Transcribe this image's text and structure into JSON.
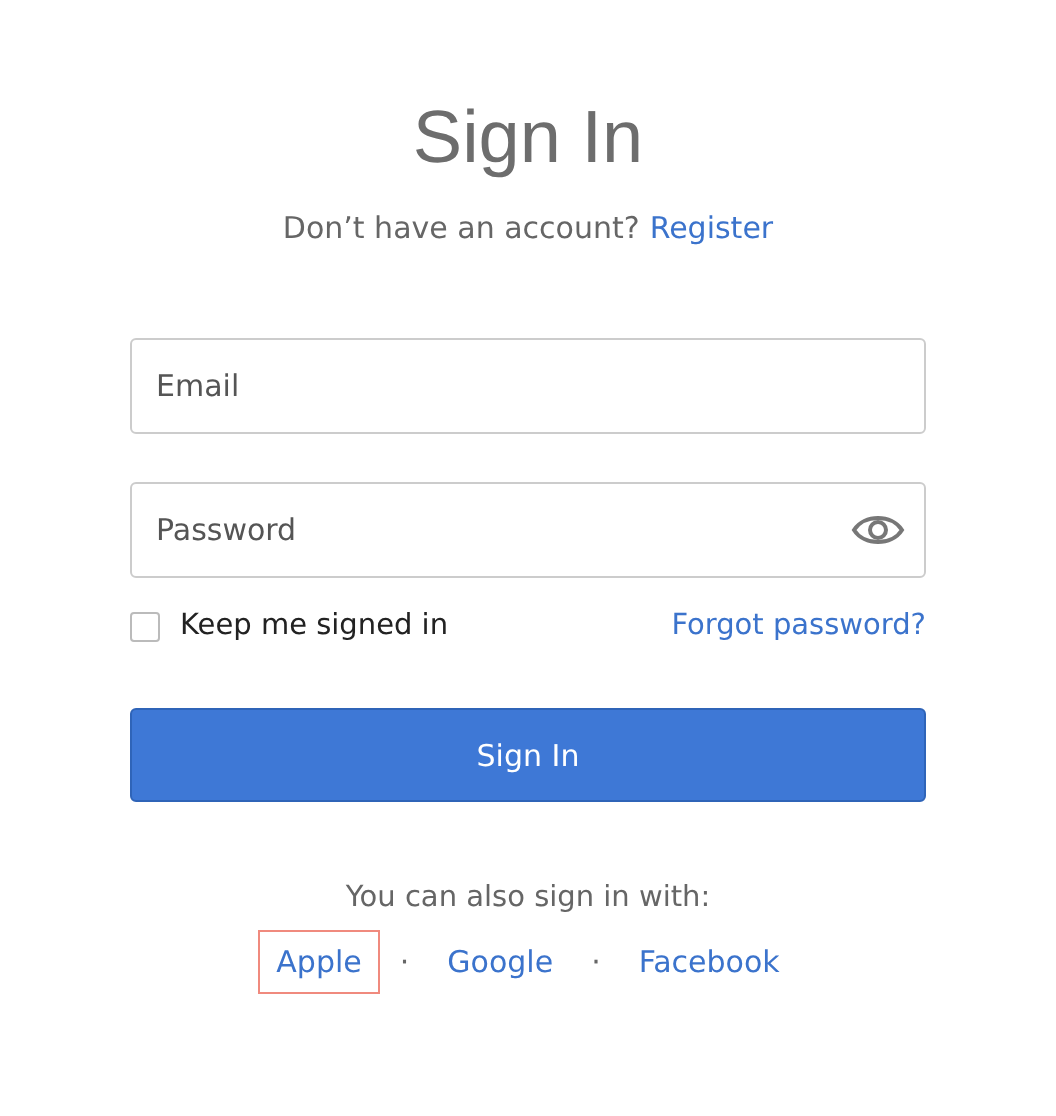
{
  "title": "Sign In",
  "register_prompt": {
    "text": "Don’t have an account?",
    "link": "Register"
  },
  "fields": [
    {
      "placeholder": "Email",
      "kind": "text"
    },
    {
      "placeholder": "Password",
      "kind": "password"
    }
  ],
  "keep_signed_in": {
    "label": "Keep me signed in",
    "checked": false
  },
  "forgot_link": "Forgot password?",
  "submit": "Sign In",
  "alt_prompt": "You can also sign in with:",
  "separator": "·",
  "providers": [
    {
      "label": "Apple",
      "focused": true
    },
    {
      "label": "Google",
      "focused": false
    },
    {
      "label": "Facebook",
      "focused": false
    }
  ]
}
